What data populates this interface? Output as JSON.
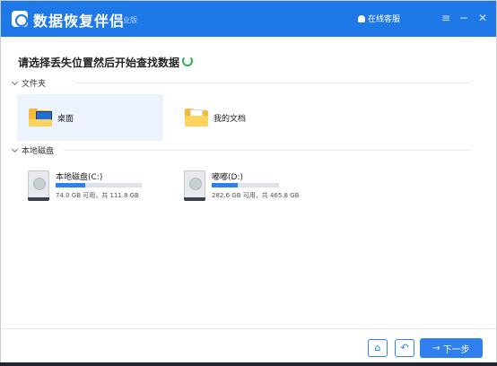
{
  "titlebar": {
    "app_title": "数据恢复伴侣",
    "edition": "专业版",
    "service_label": "在线客服",
    "menu_glyph": "≡",
    "minimize_glyph": "−",
    "close_glyph": "✕"
  },
  "main": {
    "heading": "请选择丢失位置然后开始查找数据",
    "folder_section": "文件夹",
    "folders": [
      {
        "label": "桌面",
        "selected": true
      },
      {
        "label": "我的文档",
        "selected": false
      }
    ],
    "disk_section": "本地磁盘",
    "disks": [
      {
        "name": "本地磁盘(C:)",
        "info": "74.0 GB 可用，共 111.8 GB",
        "used_fraction": 0.34
      },
      {
        "name": "嘟嘟(D:)",
        "info": "282.6 GB 可用，共 465.8 GB",
        "used_fraction": 0.39
      }
    ]
  },
  "footer": {
    "home_glyph": "⌂",
    "back_glyph": "↶",
    "next_arrow": "→",
    "next_label": "下一步"
  },
  "colors": {
    "accent": "#1f78e8",
    "button": "#2f80ed",
    "refresh": "#2bb24c",
    "folder": "#f6b93b"
  }
}
